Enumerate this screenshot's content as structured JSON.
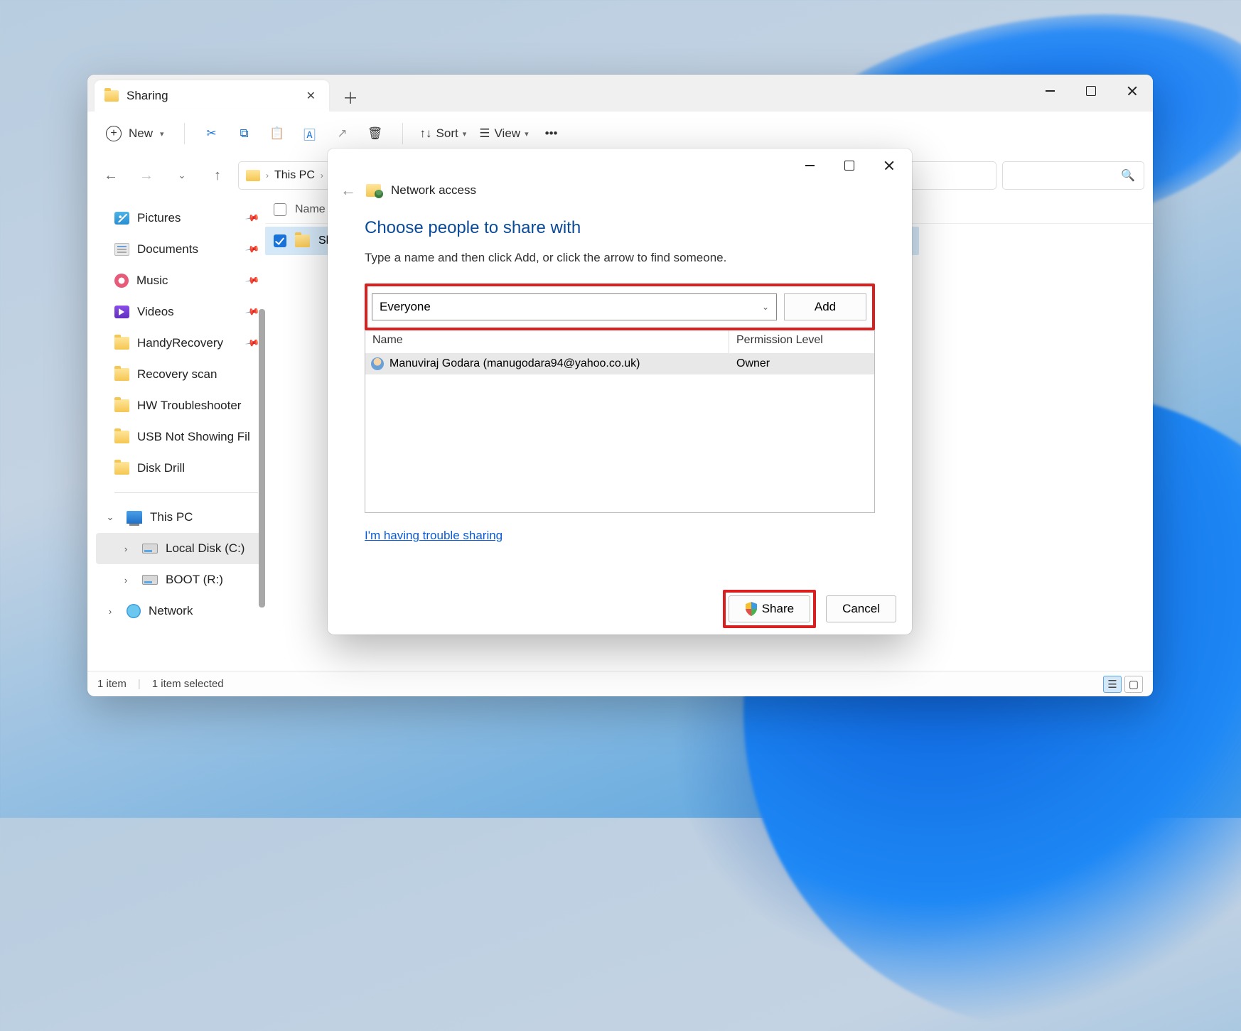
{
  "explorer": {
    "tab_title": "Sharing",
    "new_label": "New",
    "sort_label": "Sort",
    "view_label": "View",
    "breadcrumb": [
      "This PC"
    ],
    "sidebar": [
      {
        "icon": "pictures",
        "label": "Pictures",
        "pinned": true
      },
      {
        "icon": "docs",
        "label": "Documents",
        "pinned": true
      },
      {
        "icon": "music",
        "label": "Music",
        "pinned": true
      },
      {
        "icon": "videos",
        "label": "Videos",
        "pinned": true
      },
      {
        "icon": "folder",
        "label": "HandyRecovery",
        "pinned": true
      },
      {
        "icon": "folder",
        "label": "Recovery scan",
        "pinned": false
      },
      {
        "icon": "folder",
        "label": "HW Troubleshooter",
        "pinned": false
      },
      {
        "icon": "folder",
        "label": "USB Not Showing Fil",
        "pinned": false
      },
      {
        "icon": "folder",
        "label": "Disk Drill",
        "pinned": false
      }
    ],
    "this_pc_label": "This PC",
    "drives": [
      {
        "icon": "drive",
        "label": "Local Disk (C:)"
      },
      {
        "icon": "drive",
        "label": "BOOT (R:)"
      }
    ],
    "network_label": "Network",
    "content_header": "Name",
    "selected_item": "Sh",
    "status_items": "1 item",
    "status_selected": "1 item selected"
  },
  "dialog": {
    "title": "Network access",
    "heading": "Choose people to share with",
    "subtitle": "Type a name and then click Add, or click the arrow to find someone.",
    "combo_value": "Everyone",
    "add_label": "Add",
    "col_name": "Name",
    "col_perm": "Permission Level",
    "rows": [
      {
        "name": "Manuviraj Godara (manugodara94@yahoo.co.uk)",
        "perm": "Owner"
      }
    ],
    "trouble": "I'm having trouble sharing",
    "share_label": "Share",
    "cancel_label": "Cancel"
  }
}
